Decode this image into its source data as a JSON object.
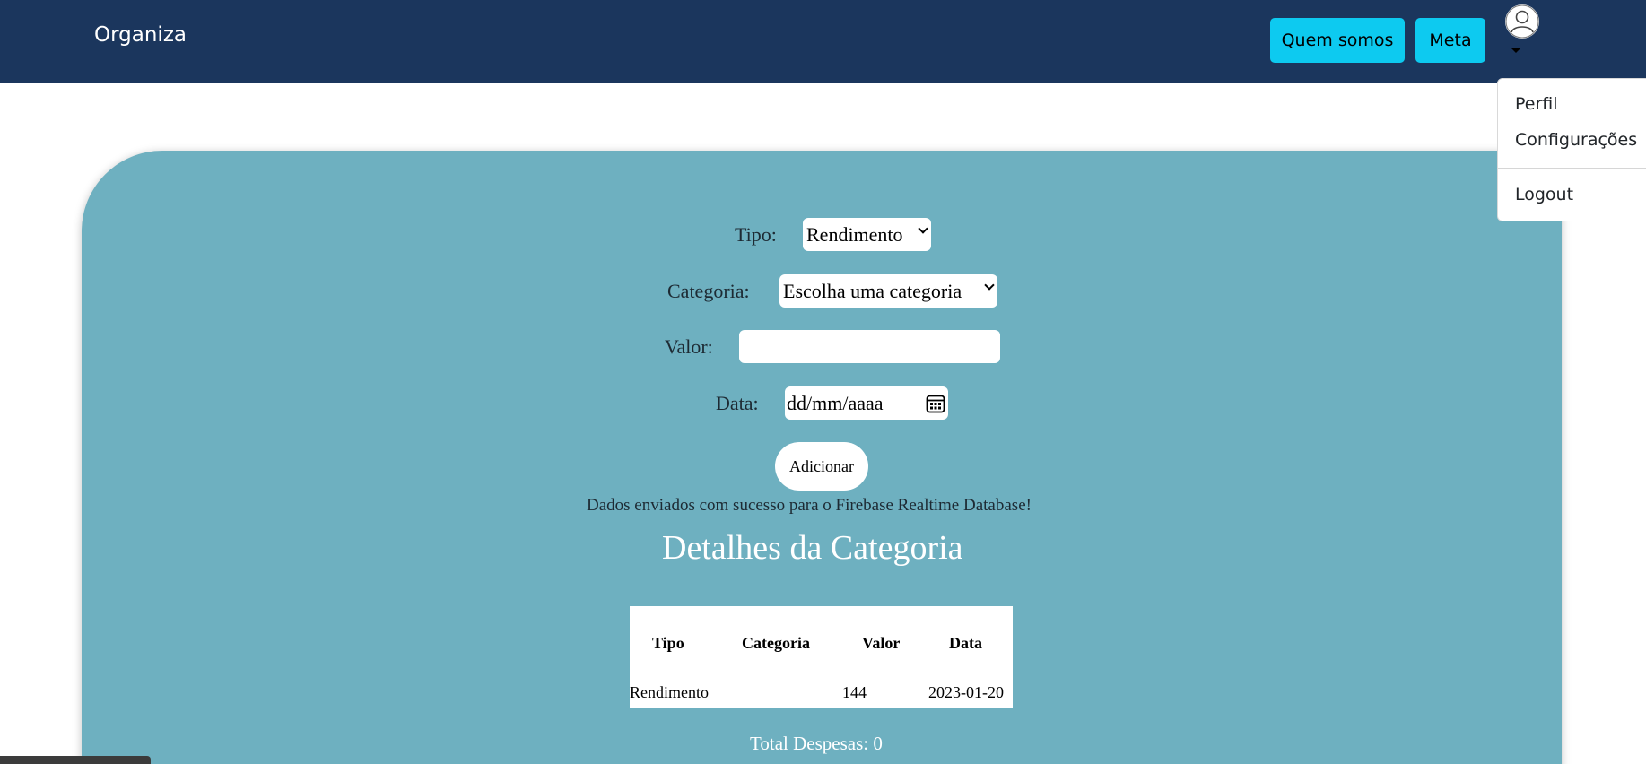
{
  "navbar": {
    "brand": "Organiza",
    "quem_somos": "Quem somos",
    "meta": "Meta",
    "avatar_icon": "user-avatar-icon",
    "caret_icon": "caret-down-icon"
  },
  "dropdown": {
    "items": [
      "Perfil",
      "Configurações"
    ],
    "logout": "Logout"
  },
  "form": {
    "tipo_label": "Tipo:",
    "tipo_value": "Rendimento",
    "categoria_label": "Categoria:",
    "categoria_value": "Escolha uma categoria",
    "valor_label": "Valor:",
    "valor_value": "",
    "data_label": "Data:",
    "data_placeholder": "dd/mm/aaaa",
    "calendar_icon": "calendar-icon",
    "add_button": "Adicionar"
  },
  "message": "Dados enviados com sucesso para o Firebase Realtime Database!",
  "details": {
    "title": "Detalhes da Categoria",
    "columns": [
      "Tipo",
      "Categoria",
      "Valor",
      "Data"
    ],
    "rows": [
      [
        "Rendimento",
        "",
        "144",
        "2023-01-20"
      ]
    ]
  },
  "total": "Total Despesas: 0",
  "colors": {
    "navbar": "#1b365d",
    "accent_button": "#0dcaf0",
    "panel": "#6eb0c0"
  }
}
